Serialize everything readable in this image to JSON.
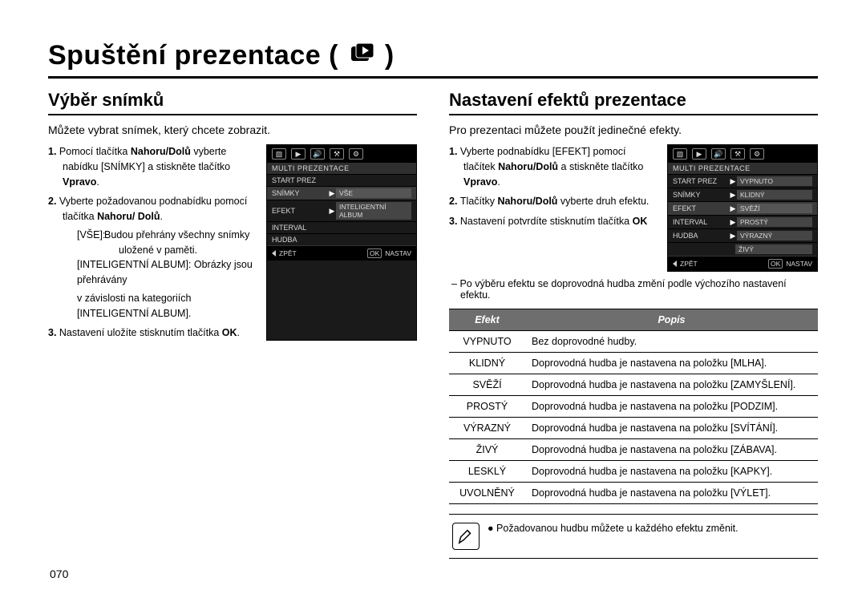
{
  "title": "Spuštění prezentace (",
  "title_suffix": ")",
  "left": {
    "heading": "Výběr snímků",
    "lead": "Můžete vybrat snímek, který chcete zobrazit.",
    "steps": {
      "s1a": "Pomocí tlačítka ",
      "s1b": "Nahoru/Dolů",
      "s1c": " vyberte nabídku [SNÍMKY] a stiskněte tlačítko ",
      "s1d": "Vpravo",
      "s1e": ".",
      "s2a": "Vyberte požadovanou podnabídku pomocí tlačítka ",
      "s2b": "Nahoru/ Dolů",
      "s2c": ".",
      "sub_vse_key": "[VŠE]:",
      "sub_vse_val": "Budou přehrány všechny snímky uložené v paměti.",
      "sub_ia_key": "[INTELIGENTNÍ ALBUM]:",
      "sub_ia_val1": "Obrázky jsou přehrávány",
      "sub_ia_val2": "v závislosti na kategoriích [INTELIGENTNÍ ALBUM].",
      "s3a": "Nastavení uložíte stisknutím tlačítka ",
      "s3b": "OK",
      "s3c": "."
    },
    "lcd": {
      "header": "MULTI PREZENTACE",
      "rows": [
        {
          "k": "START PREZ"
        },
        {
          "k": "SNÍMKY",
          "v": "VŠE",
          "sel": true
        },
        {
          "k": "EFEKT",
          "v": "INTELIGENTNÍ ALBUM"
        },
        {
          "k": "INTERVAL"
        },
        {
          "k": "HUDBA"
        }
      ],
      "foot_left": "ZPĚT",
      "foot_right_btn": "OK",
      "foot_right": "NASTAV"
    }
  },
  "right": {
    "heading": "Nastavení efektů prezentace",
    "lead": "Pro prezentaci můžete použít jedinečné efekty.",
    "steps": {
      "s1a": "Vyberte podnabídku [EFEKT] pomocí tlačítek ",
      "s1b": "Nahoru/Dolů",
      "s1c": " a stiskněte tlačítko ",
      "s1d": "Vpravo",
      "s1e": ".",
      "s2a": "Tlačítky ",
      "s2b": "Nahoru/Dolů",
      "s2c": " vyberte druh efektu.",
      "s3a": "Nastavení potvrdíte stisknutím tlačítka ",
      "s3b": "OK"
    },
    "lcd": {
      "header": "MULTI PREZENTACE",
      "rows": [
        {
          "k": "START PREZ",
          "v": "VYPNUTO"
        },
        {
          "k": "SNÍMKY",
          "v": "KLIDNÝ"
        },
        {
          "k": "EFEKT",
          "v": "SVĚŽÍ",
          "sel": true
        },
        {
          "k": "INTERVAL",
          "v": "PROSTÝ"
        },
        {
          "k": "HUDBA",
          "v": "VÝRAZNÝ"
        }
      ],
      "extra": {
        "v": "ŽIVÝ"
      },
      "foot_left": "ZPĚT",
      "foot_right_btn": "OK",
      "foot_right": "NASTAV"
    },
    "dash": "Po výběru efektu se doprovodná hudba změní podle výchozího nastavení efektu.",
    "table": {
      "head_effect": "Efekt",
      "head_desc": "Popis",
      "rows": [
        {
          "name": "VYPNUTO",
          "desc": "Bez doprovodné hudby."
        },
        {
          "name": "KLIDNÝ",
          "desc": "Doprovodná hudba je nastavena na položku [MLHA]."
        },
        {
          "name": "SVĚŽÍ",
          "desc": "Doprovodná hudba je nastavena na položku [ZAMYŠLENÍ]."
        },
        {
          "name": "PROSTÝ",
          "desc": "Doprovodná hudba je nastavena na položku [PODZIM]."
        },
        {
          "name": "VÝRAZNÝ",
          "desc": "Doprovodná hudba je nastavena na položku [SVÍTÁNÍ]."
        },
        {
          "name": "ŽIVÝ",
          "desc": "Doprovodná hudba je nastavena na položku [ZÁBAVA]."
        },
        {
          "name": "LESKLÝ",
          "desc": "Doprovodná hudba je nastavena na položku [KAPKY]."
        },
        {
          "name": "UVOLNĚNÝ",
          "desc": "Doprovodná hudba je nastavena na položku [VÝLET]."
        }
      ]
    },
    "note": "Požadovanou hudbu můžete u každého efektu změnit."
  },
  "page_number": "070"
}
